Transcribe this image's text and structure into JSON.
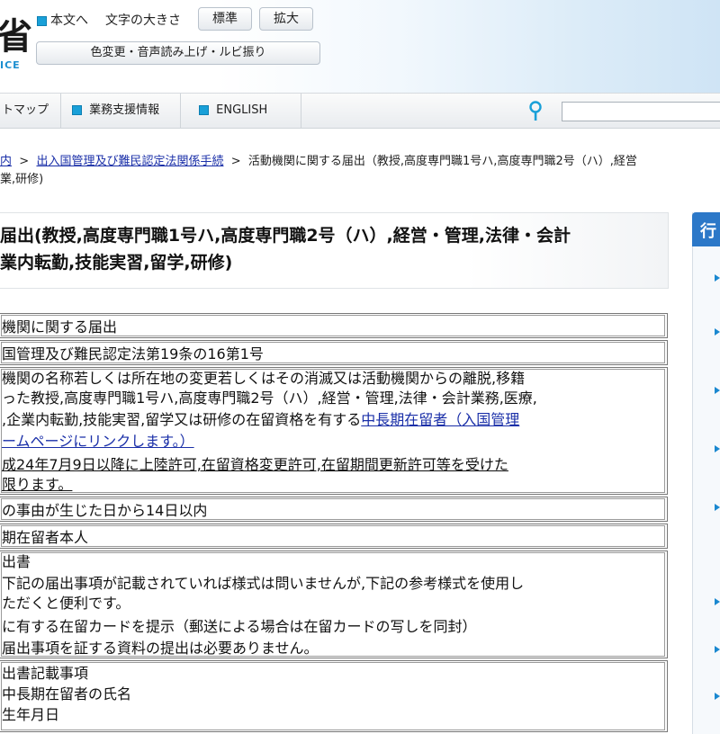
{
  "header": {
    "logo_glyph": "省",
    "logo_sub": "ICE",
    "skip_link": "本文へ",
    "font_size_label": "文字の大きさ",
    "btn_standard": "標準",
    "btn_enlarge": "拡大",
    "btn_accessibility": "色変更・音声読み上げ・ルビ振り"
  },
  "nav": {
    "sitemap": "トマップ",
    "business": "業務支援情報",
    "english": "ENGLISH",
    "search_placeholder": ""
  },
  "breadcrumb": {
    "item1": "内",
    "sep": ">",
    "item2": "出入国管理及び難民認定法関係手続",
    "current_line1": "活動機関に関する届出（教授,高度専門職1号ハ,高度専門職2号（ハ）,経営",
    "current_line2": "業,研修)"
  },
  "title": {
    "line1": "届出(教授,高度専門職1号ハ,高度専門職2号（ハ）,経営・管理,法律・会計",
    "line2": "業内転勤,技能実習,留学,研修)"
  },
  "side": {
    "heading": "行"
  },
  "rows": {
    "r1": "機関に関する届出",
    "r2": "国管理及び難民認定法第19条の16第1号",
    "r3_l1": "機関の名称若しくは所在地の変更若しくはその消滅又は活動機関からの離脱,移籍",
    "r3_l2": "った教授,高度専門職1号ハ,高度専門職2号（ハ）,経営・管理,法律・会計業務,医療,",
    "r3_l3a": ",企業内転勤,技能実習,留学又は研修の在留資格を有する",
    "r3_l3link": "中長期在留者（入国管理",
    "r3_l4link": "ームページにリンクします。）",
    "r3_l5": "成24年7月9日以降に上陸許可,在留資格変更許可,在留期間更新許可等を受けた",
    "r3_l6": "限ります。",
    "r4": "の事由が生じた日から14日以内",
    "r5": "期在留者本人",
    "r6_l1": "出書",
    "r6_l2": "下記の届出事項が記載されていれば様式は問いませんが,下記の参考様式を使用し",
    "r6_l3": "ただくと便利です。",
    "r6_l4": "に有する在留カードを提示（郵送による場合は在留カードの写しを同封）",
    "r6_l5": "届出事項を証する資料の提出は必要ありません。",
    "r7_l1": "出書記載事項",
    "r7_l2": "中長期在留者の氏名",
    "r7_l3": "生年月日"
  }
}
